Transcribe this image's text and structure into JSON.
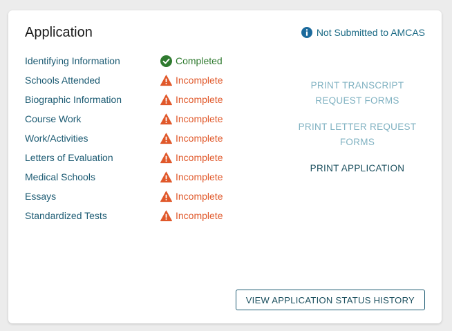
{
  "card": {
    "title": "Application",
    "submission_status": {
      "icon": "info-icon",
      "text": "Not Submitted to AMCAS",
      "color": "#1b6a85"
    }
  },
  "sections": [
    {
      "name": "Identifying Information",
      "status": "Completed",
      "state": "completed",
      "icon": "check-circle-icon"
    },
    {
      "name": "Schools Attended",
      "status": "Incomplete",
      "state": "incomplete",
      "icon": "warning-icon"
    },
    {
      "name": "Biographic Information",
      "status": "Incomplete",
      "state": "incomplete",
      "icon": "warning-icon"
    },
    {
      "name": "Course Work",
      "status": "Incomplete",
      "state": "incomplete",
      "icon": "warning-icon"
    },
    {
      "name": "Work/Activities",
      "status": "Incomplete",
      "state": "incomplete",
      "icon": "warning-icon"
    },
    {
      "name": "Letters of Evaluation",
      "status": "Incomplete",
      "state": "incomplete",
      "icon": "warning-icon"
    },
    {
      "name": "Medical Schools",
      "status": "Incomplete",
      "state": "incomplete",
      "icon": "warning-icon"
    },
    {
      "name": "Essays",
      "status": "Incomplete",
      "state": "incomplete",
      "icon": "warning-icon"
    },
    {
      "name": "Standardized Tests",
      "status": "Incomplete",
      "state": "incomplete",
      "icon": "warning-icon"
    }
  ],
  "actions": {
    "print_transcript": "PRINT TRANSCRIPT REQUEST FORMS",
    "print_letter": "PRINT LETTER REQUEST FORMS",
    "print_application": "PRINT APPLICATION"
  },
  "history_button": "VIEW APPLICATION STATUS HISTORY",
  "colors": {
    "completed": "#2f7a2f",
    "incomplete": "#e0582a",
    "link": "#1b5a72",
    "muted_link": "#7fb1c1"
  }
}
